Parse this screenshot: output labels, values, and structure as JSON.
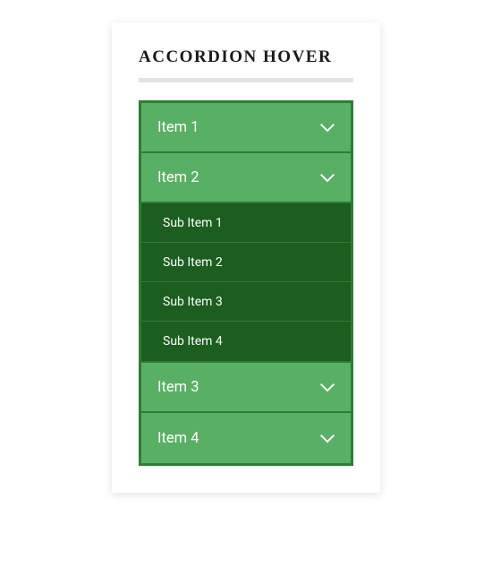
{
  "title": "ACCORDION HOVER",
  "items": [
    {
      "label": "Item 1",
      "expanded": false
    },
    {
      "label": "Item 2",
      "expanded": true,
      "sub": [
        {
          "label": "Sub Item 1"
        },
        {
          "label": "Sub Item 2"
        },
        {
          "label": "Sub Item 3"
        },
        {
          "label": "Sub Item 4"
        }
      ]
    },
    {
      "label": "Item 3",
      "expanded": false
    },
    {
      "label": "Item 4",
      "expanded": false
    }
  ]
}
